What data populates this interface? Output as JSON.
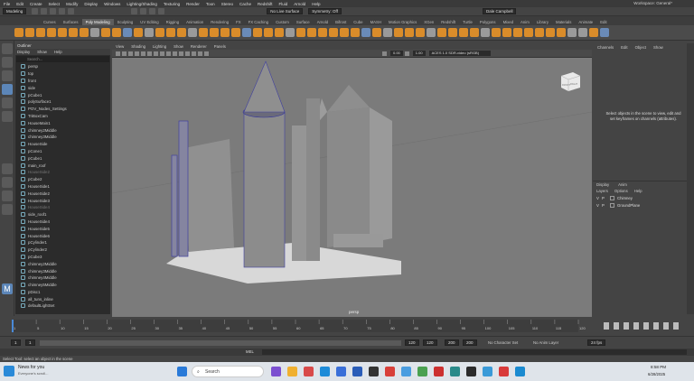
{
  "menubar": {
    "items": [
      "File",
      "Edit",
      "Create",
      "Select",
      "Modify",
      "Display",
      "Windows",
      "Lighting/Shading",
      "Texturing",
      "Render",
      "Toon",
      "Stereo",
      "Cache",
      "Redshift",
      "Fluid",
      "Arnold",
      "Help"
    ],
    "workspace_label": "Workspace:",
    "workspace_value": "General*"
  },
  "statusline": {
    "mode": "Modeling",
    "no_live_surface": "No Live Surface",
    "symmetry": "Symmetry: Off",
    "user": "Dale Campbell"
  },
  "shelf_tabs": [
    "Curves",
    "Surfaces",
    "Poly Modeling",
    "Sculpting",
    "UV Editing",
    "Rigging",
    "Animation",
    "Rendering",
    "FX",
    "FX Caching",
    "Custom",
    "Surface",
    "Arnold",
    "Bifrost",
    "Cube",
    "MASH",
    "Motion Graphics",
    "XGen",
    "Redshift",
    "Turtle",
    "Polygons",
    "Mixed",
    "Anim",
    "Library",
    "Materials",
    "Animate",
    "Edit"
  ],
  "outliner": {
    "title": "Outliner",
    "menu": [
      "Display",
      "Show",
      "Help"
    ],
    "search_placeholder": "Search...",
    "items": [
      {
        "label": "persp",
        "dim": false
      },
      {
        "label": "top",
        "dim": false
      },
      {
        "label": "front",
        "dim": false
      },
      {
        "label": "side",
        "dim": false
      },
      {
        "label": "pCube1",
        "dim": false
      },
      {
        "label": "polySurface1",
        "dim": false
      },
      {
        "label": "POV_Nodes_Settings",
        "dim": false
      },
      {
        "label": "TriBoxCam",
        "dim": false
      },
      {
        "label": "HouseMain1",
        "dim": false
      },
      {
        "label": "chimney2Middle",
        "dim": false
      },
      {
        "label": "chimney3Middle",
        "dim": false
      },
      {
        "label": "HouseSide",
        "dim": false
      },
      {
        "label": "pCone1",
        "dim": false
      },
      {
        "label": "pCube1",
        "dim": false
      },
      {
        "label": "main_roof",
        "dim": false
      },
      {
        "label": "HouseSide2",
        "dim": true
      },
      {
        "label": "pCube2",
        "dim": false
      },
      {
        "label": "HouseSide1",
        "dim": false
      },
      {
        "label": "HouseSide2",
        "dim": false
      },
      {
        "label": "HouseSide3",
        "dim": false
      },
      {
        "label": "HouseSide4",
        "dim": true
      },
      {
        "label": "side_roof1",
        "dim": false
      },
      {
        "label": "HouseSide4",
        "dim": false
      },
      {
        "label": "HouseSide5",
        "dim": false
      },
      {
        "label": "HouseSide6",
        "dim": false
      },
      {
        "label": "pCylinder1",
        "dim": false
      },
      {
        "label": "pCylinder2",
        "dim": false
      },
      {
        "label": "pCube3",
        "dim": false
      },
      {
        "label": "chimney2Middle",
        "dim": false
      },
      {
        "label": "chimney3Middle",
        "dim": false
      },
      {
        "label": "chimney4Middle",
        "dim": false
      },
      {
        "label": "chimney5Middle",
        "dim": false
      },
      {
        "label": "pDisc1",
        "dim": false
      },
      {
        "label": "all_tuns_inline",
        "dim": false
      },
      {
        "label": "defaultLightSet",
        "dim": false
      }
    ]
  },
  "viewport": {
    "menu": [
      "View",
      "Shading",
      "Lighting",
      "Show",
      "Renderer",
      "Panels"
    ],
    "field1": "0.00",
    "field2": "1.00",
    "colorspace": "ACES 1.0 SDR-video (sRGB)",
    "label": "persp",
    "cube_front": "FRONT",
    "cube_right": "RIGHT"
  },
  "channelbox": {
    "menu": [
      "Channels",
      "Edit",
      "Object",
      "Show"
    ],
    "message": "Select objects in the scene to view, edit and set keyframes on channels (attributes)."
  },
  "layers": {
    "tabs": [
      "Display",
      "Anim"
    ],
    "menu": [
      "Layers",
      "Options",
      "Help"
    ],
    "rows": [
      {
        "v": "V",
        "p": "P",
        "name": "Chimney"
      },
      {
        "v": "V",
        "p": "P",
        "name": "GroundPlane"
      }
    ]
  },
  "timeline": {
    "ticks": [
      "1",
      "5",
      "10",
      "15",
      "20",
      "25",
      "30",
      "35",
      "40",
      "45",
      "50",
      "55",
      "60",
      "65",
      "70",
      "75",
      "80",
      "85",
      "90",
      "95",
      "100",
      "105",
      "110",
      "115",
      "120"
    ],
    "current_frame": "1"
  },
  "range": {
    "start": "1",
    "inner_start": "1",
    "inner_end": "120",
    "end_a": "120",
    "end_b": "200",
    "end_c": "200",
    "character_set": "No Character Set",
    "anim_layer": "No Anim Layer",
    "fps": "24 fps"
  },
  "cmdline": {
    "label": "MEL"
  },
  "helpline": {
    "text": "Select Tool: select an object in the scene"
  },
  "taskbar": {
    "news_title": "News for you",
    "news_sub": "Everyone's scroll...",
    "search": "Search",
    "time": "8:58 PM",
    "date": "6/28/2025"
  }
}
